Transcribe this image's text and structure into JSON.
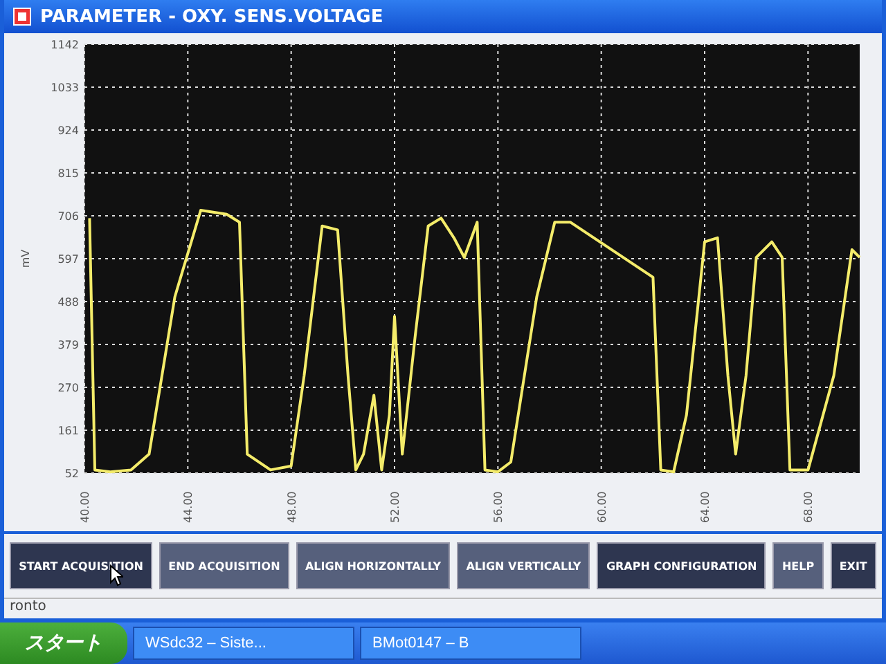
{
  "window": {
    "title": "PARAMETER - OXY. SENS.VOLTAGE"
  },
  "chart": {
    "chart_data": {
      "type": "line",
      "ylabel": "mV",
      "xlim": [
        40,
        70
      ],
      "ylim": [
        52,
        1142
      ],
      "xticks": [
        {
          "value": 40,
          "label": "40.00"
        },
        {
          "value": 44,
          "label": "44.00"
        },
        {
          "value": 48,
          "label": "48.00"
        },
        {
          "value": 52,
          "label": "52.00"
        },
        {
          "value": 56,
          "label": "56.00"
        },
        {
          "value": 60,
          "label": "60.00"
        },
        {
          "value": 64,
          "label": "64.00"
        },
        {
          "value": 68,
          "label": "68.00"
        }
      ],
      "yticks": [
        52,
        161,
        270,
        379,
        488,
        597,
        706,
        815,
        924,
        1033,
        1142
      ],
      "x": [
        40.2,
        40.4,
        41,
        41.8,
        42.5,
        43.5,
        44.5,
        45.5,
        46,
        46.3,
        47.2,
        48,
        48.5,
        49.2,
        49.8,
        50.2,
        50.5,
        50.8,
        51.2,
        51.5,
        51.8,
        52,
        52.3,
        52.8,
        53.3,
        53.8,
        54.3,
        54.7,
        55.2,
        55.5,
        56,
        56.5,
        57.5,
        58.2,
        58.8,
        62,
        62.3,
        62.8,
        63.3,
        64,
        64.5,
        64.9,
        65.2,
        65.6,
        66,
        66.6,
        67,
        67.3,
        68,
        69,
        69.7,
        70
      ],
      "grid": true,
      "series": [
        {
          "color": "#f4ec6a",
          "values": [
            700,
            60,
            55,
            60,
            100,
            500,
            720,
            710,
            690,
            100,
            60,
            70,
            300,
            680,
            670,
            300,
            60,
            100,
            250,
            60,
            200,
            450,
            100,
            400,
            680,
            700,
            650,
            600,
            690,
            60,
            55,
            80,
            500,
            690,
            690,
            550,
            60,
            55,
            200,
            640,
            650,
            300,
            100,
            300,
            600,
            640,
            600,
            60,
            60,
            300,
            620,
            600
          ]
        }
      ]
    }
  },
  "buttons": [
    {
      "label": "START ACQUISITION",
      "kind": "dark"
    },
    {
      "label": "END ACQUISITION",
      "kind": "light"
    },
    {
      "label": "ALIGN HORIZONTALLY",
      "kind": "light"
    },
    {
      "label": "ALIGN VERTICALLY",
      "kind": "light"
    },
    {
      "label": "GRAPH CONFIGURATION",
      "kind": "dark"
    },
    {
      "label": "HELP",
      "kind": "light"
    },
    {
      "label": "EXIT",
      "kind": "dark"
    }
  ],
  "status_bar": "ronto",
  "taskbar": {
    "start": "スタート",
    "tasks": [
      "WSdc32 – Siste...",
      "BMot0147 – B"
    ]
  }
}
